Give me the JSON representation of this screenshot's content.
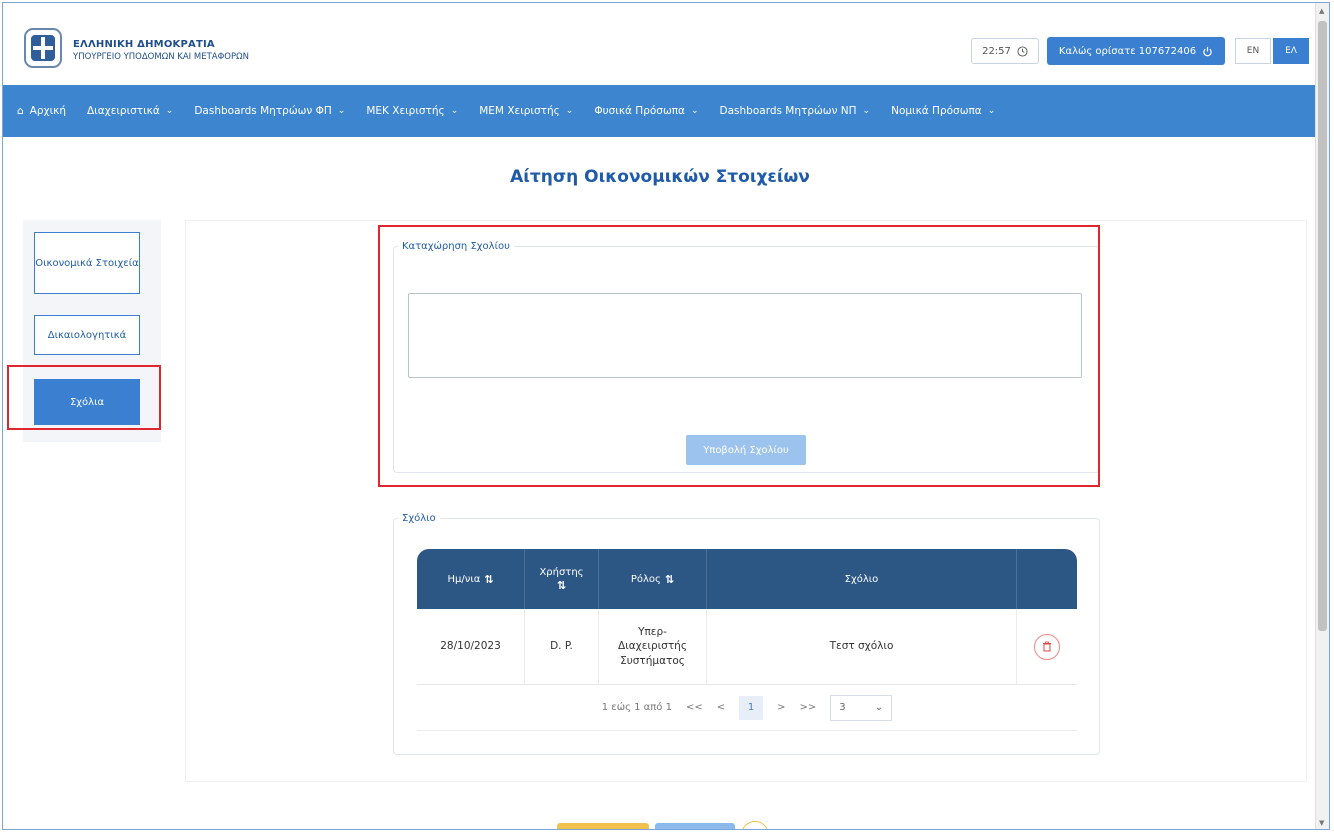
{
  "header": {
    "gov_name": "ΕΛΛΗΝΙΚΗ ΔΗΜΟΚΡΑΤΙΑ",
    "ministry": "ΥΠΟΥΡΓΕΙΟ ΥΠΟΔΟΜΩΝ ΚΑΙ ΜΕΤΑΦΟΡΩΝ",
    "time": "22:57",
    "welcome": "Καλώς ορίσατε 107672406",
    "lang_en": "EN",
    "lang_el": "ΕΛ"
  },
  "nav": {
    "items": [
      {
        "label": "Αρχική"
      },
      {
        "label": "Διαχειριστικά"
      },
      {
        "label": "Dashboards Μητρώων ΦΠ"
      },
      {
        "label": "ΜΕΚ Χειριστής"
      },
      {
        "label": "ΜΕΜ Χειριστής"
      },
      {
        "label": "Φυσικά Πρόσωπα"
      },
      {
        "label": "Dashboards Μητρώων ΝΠ"
      },
      {
        "label": "Νομικά Πρόσωπα"
      }
    ]
  },
  "page": {
    "title": "Αίτηση Οικονομικών Στοιχείων"
  },
  "side": {
    "items": [
      {
        "label": "Οικονομικά Στοιχεία"
      },
      {
        "label": "Δικαιολογητικά"
      },
      {
        "label": "Σχόλια"
      }
    ]
  },
  "comment_form": {
    "legend": "Καταχώρηση Σχολίου",
    "textarea_value": "",
    "submit_label": "Υποβολή Σχολίου"
  },
  "comments": {
    "legend": "Σχόλιο",
    "columns": [
      "Ημ/νια",
      "Χρήστης",
      "Ρόλος",
      "Σχόλιο",
      ""
    ],
    "rows": [
      {
        "date": "28/10/2023",
        "user": "D. P.",
        "role": "Υπερ-Διαχειριστής Συστήματος",
        "comment": "Τεστ σχόλιο"
      }
    ],
    "pager": {
      "summary": "1 εώς 1 από 1",
      "first": "<<",
      "prev": "<",
      "current": "1",
      "next": ">",
      "last": ">>",
      "page_size": "3"
    }
  },
  "colors": {
    "accent": "#3a7fd0",
    "nav": "#3d86cf",
    "table_header": "#2c5684",
    "highlight": "#e0262f"
  },
  "icons": [
    "logo-emblem",
    "clock-icon",
    "power-icon",
    "home-icon",
    "chevron-down-icon",
    "sort-icon",
    "trash-icon"
  ]
}
